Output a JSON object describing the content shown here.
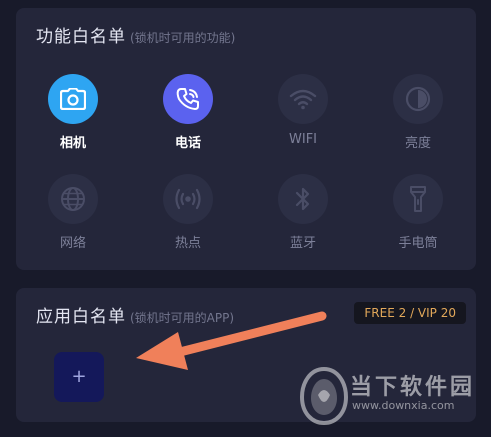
{
  "function_whitelist": {
    "title": "功能白名单",
    "subtitle": "(锁机时可用的功能)",
    "items": [
      {
        "label": "相机",
        "icon": "camera-icon",
        "active": true,
        "color": "#2ea5f2"
      },
      {
        "label": "电话",
        "icon": "phone-icon",
        "active": true,
        "color": "#5b62ef"
      },
      {
        "label": "WIFI",
        "icon": "wifi-icon",
        "active": false
      },
      {
        "label": "亮度",
        "icon": "brightness-icon",
        "active": false
      },
      {
        "label": "网络",
        "icon": "globe-icon",
        "active": false
      },
      {
        "label": "热点",
        "icon": "hotspot-icon",
        "active": false
      },
      {
        "label": "蓝牙",
        "icon": "bluetooth-icon",
        "active": false
      },
      {
        "label": "手电筒",
        "icon": "flashlight-icon",
        "active": false
      }
    ]
  },
  "app_whitelist": {
    "title": "应用白名单",
    "subtitle": "(锁机时可用的APP)",
    "vip_badge": "FREE 2 / VIP 20",
    "add_button": "+"
  },
  "watermark": {
    "name": "当下软件园",
    "url": "www.downxia.com"
  },
  "colors": {
    "background": "#181a2a",
    "card": "#24263a",
    "inactive_icon_bg": "#2c2f45",
    "badge_text": "#e2a85a",
    "arrow": "#f0805a"
  }
}
